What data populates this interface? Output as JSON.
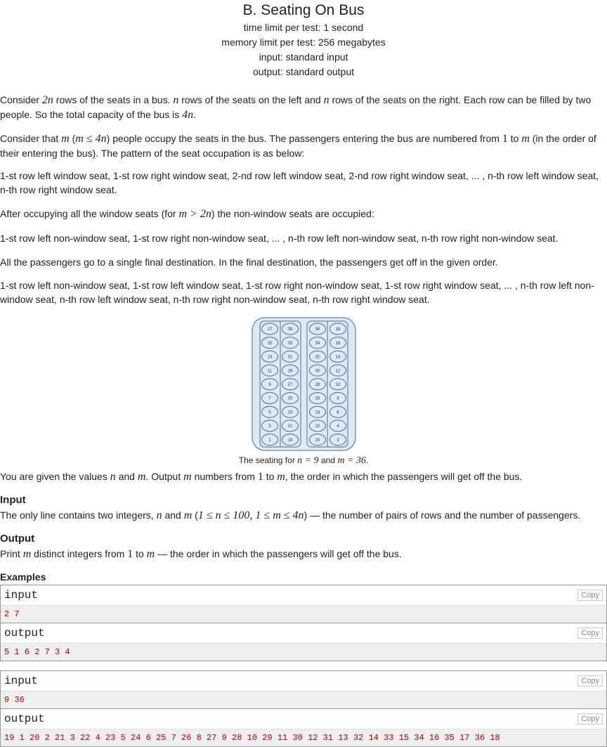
{
  "header": {
    "title": "B. Seating On Bus",
    "time_limit": "time limit per test: 1 second",
    "memory_limit": "memory limit per test: 256 megabytes",
    "input": "input: standard input",
    "output": "output: standard output"
  },
  "statement": {
    "p1a": "Consider ",
    "p1b": "2n",
    "p1c": " rows of the seats in a bus. ",
    "p1d": "n",
    "p1e": " rows of the seats on the left and ",
    "p1f": "n",
    "p1g": " rows of the seats on the right. Each row can be filled by two people. So the total capacity of the bus is ",
    "p1h": "4n",
    "p1i": ".",
    "p2a": "Consider that ",
    "p2b": "m",
    "p2c": " (",
    "p2d": "m ≤ 4n",
    "p2e": ") people occupy the seats in the bus. The passengers entering the bus are numbered from ",
    "p2f": "1",
    "p2g": " to ",
    "p2h": "m",
    "p2i": " (in the order of their entering the bus). The pattern of the seat occupation is as below:",
    "p3": "1-st row left window seat, 1-st row right window seat, 2-nd row left window seat, 2-nd row right window seat, ... , n-th row left window seat, n-th row right window seat.",
    "p4a": "After occupying all the window seats (for ",
    "p4b": "m > 2n",
    "p4c": ") the non-window seats are occupied:",
    "p5": "1-st row left non-window seat, 1-st row right non-window seat, ... , n-th row left non-window seat, n-th row right non-window seat.",
    "p6": "All the passengers go to a single final destination. In the final destination, the passengers get off in the given order.",
    "p7": "1-st row left non-window seat, 1-st row left window seat, 1-st row right non-window seat, 1-st row right window seat, ... , n-th row left non-window seat, n-th row left window seat, n-th row right non-window seat, n-th row right window seat.",
    "caption_a": "The seating for ",
    "caption_b": "n = 9",
    "caption_c": " and ",
    "caption_d": "m = 36",
    "caption_e": ".",
    "p8a": "You are given the values ",
    "p8b": "n",
    "p8c": " and ",
    "p8d": "m",
    "p8e": ". Output ",
    "p8f": "m",
    "p8g": " numbers from ",
    "p8h": "1",
    "p8i": " to ",
    "p8j": "m",
    "p8k": ", the order in which the passengers will get off the bus."
  },
  "figure": {
    "left_window": [
      "17",
      "15",
      "13",
      "11",
      "9",
      "7",
      "5",
      "3",
      "1"
    ],
    "left_aisle": [
      "35",
      "33",
      "31",
      "29",
      "27",
      "25",
      "23",
      "21",
      "19"
    ],
    "right_aisle": [
      "36",
      "34",
      "32",
      "30",
      "28",
      "26",
      "24",
      "22",
      "20"
    ],
    "right_window": [
      "18",
      "16",
      "14",
      "12",
      "10",
      "8",
      "6",
      "4",
      "2"
    ],
    "colors": {
      "bus_fill": "#dde9f5",
      "seat_fill": "#dde9f5",
      "stroke": "#4a6b8a"
    }
  },
  "input_section": {
    "heading": "Input",
    "text_a": "The only line contains two integers, ",
    "text_b": "n",
    "text_c": " and ",
    "text_d": "m",
    "text_e": " (",
    "text_f": "1 ≤ n ≤ 100, 1 ≤ m ≤ 4n",
    "text_g": ") — the number of pairs of rows and the number of passengers."
  },
  "output_section": {
    "heading": "Output",
    "text_a": "Print ",
    "text_b": "m",
    "text_c": " distinct integers from ",
    "text_d": "1",
    "text_e": " to ",
    "text_f": "m",
    "text_g": " — the order in which the passengers will get off the bus."
  },
  "examples": {
    "heading": "Examples",
    "input_label": "input",
    "output_label": "output",
    "copy_label": "Copy",
    "ex1_input": "2 7",
    "ex1_output": "5 1 6 2 7 3 4",
    "ex2_input": "9 36",
    "ex2_output": "19 1 20 2 21 3 22 4 23 5 24 6 25 7 26 8 27 9 28 10 29 11 30 12 31 13 32 14 33 15 34 16 35 17 36 18"
  }
}
